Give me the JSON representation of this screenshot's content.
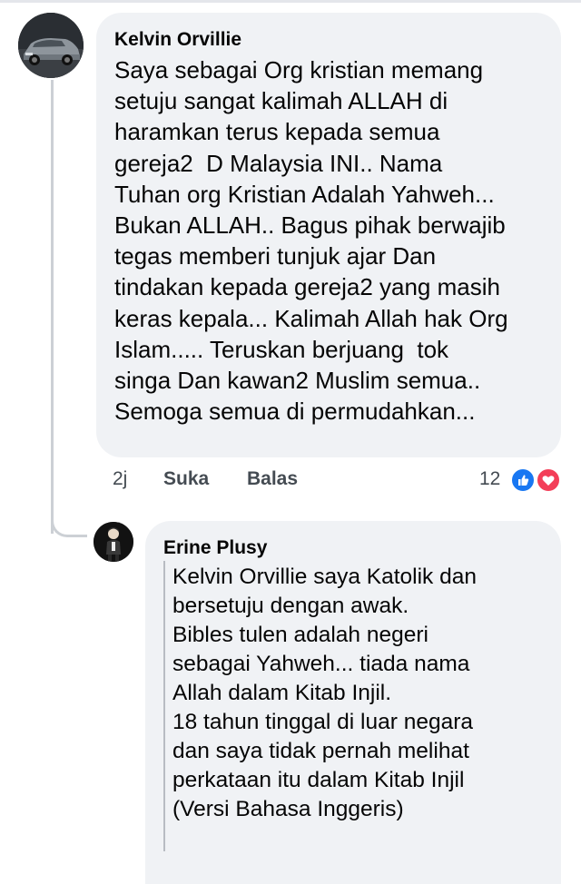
{
  "comment": {
    "author": "Kelvin Orvillie",
    "avatar_icon": "car-avatar-icon",
    "text": "Saya sebagai Org kristian memang\nsetuju sangat kalimah ALLAH di\nharamkan terus kepada semua\ngereja2  D Malaysia INI.. Nama\nTuhan org Kristian Adalah Yahweh...\nBukan ALLAH.. Bagus pihak berwajib\ntegas memberi tunjuk ajar Dan\ntindakan kepada gereja2 yang masih\nkeras kepala... Kalimah Allah hak Org\nIslam..... Teruskan berjuang  tok\nsinga Dan kawan2 Muslim semua..\nSemoga semua di permudahkan...",
    "time": "2j",
    "like_label": "Suka",
    "reply_label": "Balas",
    "reaction_count": "12",
    "reaction_icons": [
      "like-reaction-icon",
      "love-reaction-icon"
    ],
    "colors": {
      "like": "#1877f2",
      "love": "#f33e58",
      "bubble": "#f0f2f5"
    }
  },
  "reply": {
    "author": "Erine Plusy",
    "avatar_icon": "person-avatar-icon",
    "text": "Kelvin Orvillie saya Katolik dan\nbersetuju dengan awak.\nBibles tulen adalah negeri\nsebagai Yahweh... tiada nama\nAllah dalam Kitab Injil.\n18 tahun tinggal di luar negara\ndan saya tidak pernah melihat\nperkataan itu dalam Kitab Injil\n(Versi Bahasa Inggeris)"
  }
}
